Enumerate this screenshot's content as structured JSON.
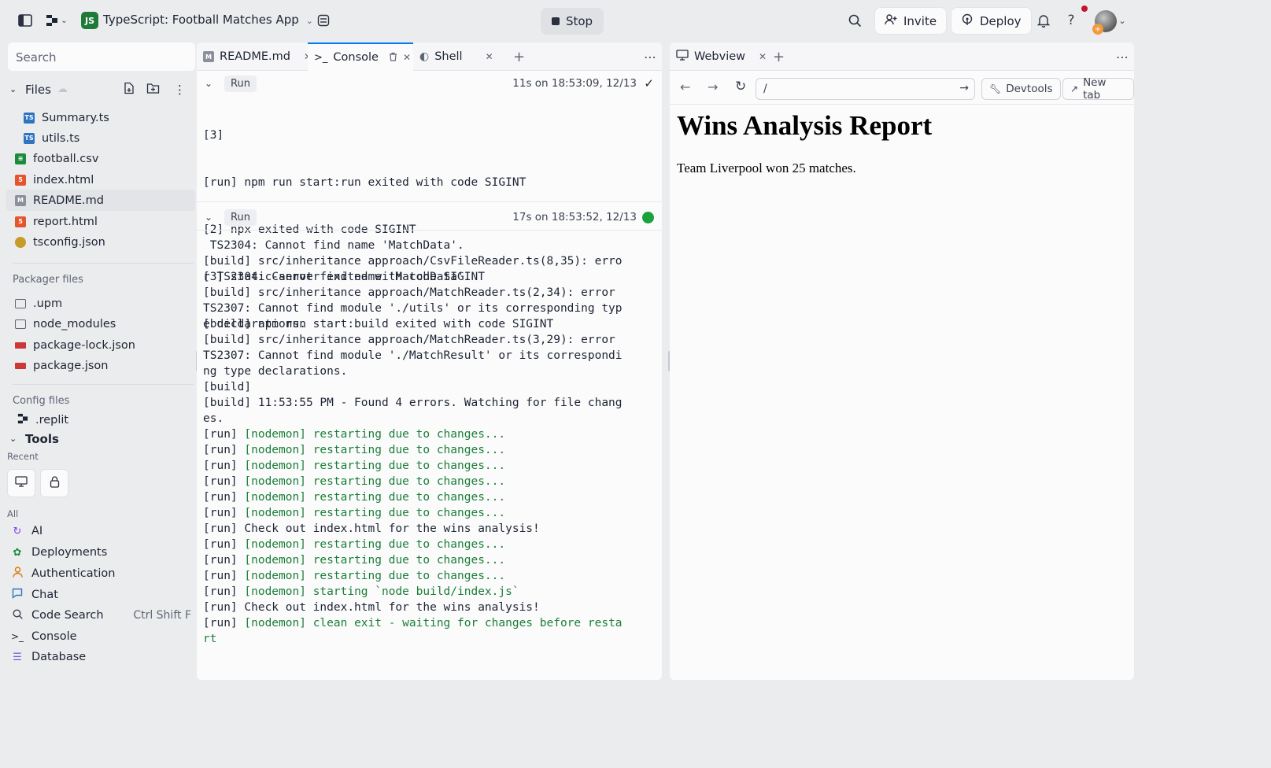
{
  "topbar": {
    "project_title": "TypeScript: Football Matches App",
    "stop_label": "Stop",
    "invite_label": "Invite",
    "deploy_label": "Deploy",
    "help_label": "?"
  },
  "sidebar": {
    "search_placeholder": "Search",
    "files_label": "Files",
    "files": [
      {
        "name": "Summary.ts",
        "icon": "ts-file-icon"
      },
      {
        "name": "utils.ts",
        "icon": "ts-file-icon"
      },
      {
        "name": "football.csv",
        "icon": "csv-file-icon"
      },
      {
        "name": "index.html",
        "icon": "html-file-icon"
      },
      {
        "name": "README.md",
        "icon": "markdown-file-icon"
      },
      {
        "name": "report.html",
        "icon": "html-file-icon"
      },
      {
        "name": "tsconfig.json",
        "icon": "json-file-icon"
      }
    ],
    "packager_label": "Packager files",
    "packager_files": [
      {
        "name": ".upm",
        "icon": "folder-icon"
      },
      {
        "name": "node_modules",
        "icon": "folder-icon"
      },
      {
        "name": "package-lock.json",
        "icon": "npm-icon"
      },
      {
        "name": "package.json",
        "icon": "npm-icon"
      }
    ],
    "config_label": "Config files",
    "config_files": [
      {
        "name": ".replit",
        "icon": "replit-icon"
      }
    ],
    "tools_label": "Tools",
    "recent_label": "Recent",
    "all_label": "All",
    "tools": [
      {
        "name": "AI",
        "icon": "ai-icon",
        "shortcut": ""
      },
      {
        "name": "Deployments",
        "icon": "deployments-icon",
        "shortcut": ""
      },
      {
        "name": "Authentication",
        "icon": "user-icon",
        "shortcut": ""
      },
      {
        "name": "Chat",
        "icon": "chat-icon",
        "shortcut": ""
      },
      {
        "name": "Code Search",
        "icon": "search-icon",
        "shortcut": "Ctrl Shift F"
      },
      {
        "name": "Console",
        "icon": "terminal-icon",
        "shortcut": ""
      },
      {
        "name": "Database",
        "icon": "database-icon",
        "shortcut": ""
      }
    ]
  },
  "console": {
    "tabs": [
      {
        "label": "README.md"
      },
      {
        "label": "Console"
      },
      {
        "label": "Shell"
      }
    ],
    "run1": {
      "label": "Run",
      "time": "11s on 18:53:09, 12/13",
      "lines": [
        "[3]",
        "[run] npm run start:run exited with code SIGINT",
        "[2] npx exited with code SIGINT",
        "[3] static-server exited with code SIGINT",
        "[build] npm run start:build exited with code SIGINT"
      ]
    },
    "run2": {
      "label": "Run",
      "time": "17s on 18:53:52, 12/13",
      "lines": [
        {
          "prefix": " TS2304: Cannot find name 'MatchData'.",
          "green": ""
        },
        {
          "prefix": "[build] src/inheritance approach/CsvFileReader.ts(8,35): erro",
          "green": ""
        },
        {
          "prefix": "r TS2304: Cannot find name 'MatchData'.",
          "green": ""
        },
        {
          "prefix": "[build] src/inheritance approach/MatchReader.ts(2,34): error",
          "green": ""
        },
        {
          "prefix": "TS2307: Cannot find module './utils' or its corresponding typ",
          "green": ""
        },
        {
          "prefix": "e declarations.",
          "green": ""
        },
        {
          "prefix": "[build] src/inheritance approach/MatchReader.ts(3,29): error",
          "green": ""
        },
        {
          "prefix": "TS2307: Cannot find module './MatchResult' or its correspondi",
          "green": ""
        },
        {
          "prefix": "ng type declarations.",
          "green": ""
        },
        {
          "prefix": "[build]",
          "green": ""
        },
        {
          "prefix": "[build] 11:53:55 PM - Found 4 errors. Watching for file chang",
          "green": ""
        },
        {
          "prefix": "es.",
          "green": ""
        },
        {
          "prefix": "[run] ",
          "green": "[nodemon] restarting due to changes..."
        },
        {
          "prefix": "[run] ",
          "green": "[nodemon] restarting due to changes..."
        },
        {
          "prefix": "[run] ",
          "green": "[nodemon] restarting due to changes..."
        },
        {
          "prefix": "[run] ",
          "green": "[nodemon] restarting due to changes..."
        },
        {
          "prefix": "[run] ",
          "green": "[nodemon] restarting due to changes..."
        },
        {
          "prefix": "[run] ",
          "green": "[nodemon] restarting due to changes..."
        },
        {
          "prefix": "[run] Check out index.html for the wins analysis!",
          "green": ""
        },
        {
          "prefix": "[run] ",
          "green": "[nodemon] restarting due to changes..."
        },
        {
          "prefix": "[run] ",
          "green": "[nodemon] restarting due to changes..."
        },
        {
          "prefix": "[run] ",
          "green": "[nodemon] restarting due to changes..."
        },
        {
          "prefix": "[run] ",
          "green": "[nodemon] starting `node build/index.js`"
        },
        {
          "prefix": "[run] Check out index.html for the wins analysis!",
          "green": ""
        },
        {
          "prefix": "[run] ",
          "green": "[nodemon] clean exit - waiting for changes before resta"
        },
        {
          "prefix": "",
          "green": "rt"
        }
      ]
    }
  },
  "webview": {
    "tab_label": "Webview",
    "url": "/",
    "devtools_label": "Devtools",
    "newtab_label": "New tab",
    "report_title": "Wins Analysis Report",
    "report_text": "Team Liverpool won 25 matches."
  },
  "colors": {
    "accent": "#0079f2",
    "terminal_green": "#1a7f37",
    "status_running": "#1ca23a",
    "project_logo": "#1f7a3a"
  }
}
